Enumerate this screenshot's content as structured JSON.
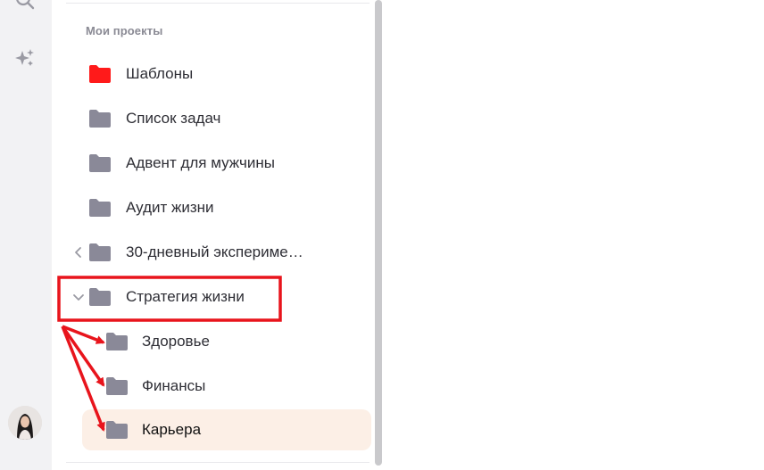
{
  "sidebar": {
    "section_title": "Мои проекты",
    "items": [
      {
        "label": "Шаблоны",
        "folder_color": "#ff1a1a",
        "chevron": "none",
        "level": 0
      },
      {
        "label": "Список задач",
        "folder_color": "#8a8998",
        "chevron": "none",
        "level": 0
      },
      {
        "label": "Адвент для мужчины",
        "folder_color": "#8a8998",
        "chevron": "none",
        "level": 0
      },
      {
        "label": "Аудит жизни",
        "folder_color": "#8a8998",
        "chevron": "none",
        "level": 0
      },
      {
        "label": "30-дневный экспериме…",
        "folder_color": "#8a8998",
        "chevron": "collapsed",
        "level": 0
      },
      {
        "label": "Стратегия жизни",
        "folder_color": "#8a8998",
        "chevron": "expanded",
        "level": 0
      },
      {
        "label": "Здоровье",
        "folder_color": "#8a8998",
        "chevron": "none",
        "level": 1
      },
      {
        "label": "Финансы",
        "folder_color": "#8a8998",
        "chevron": "none",
        "level": 1
      },
      {
        "label": "Карьера",
        "folder_color": "#8a8998",
        "chevron": "none",
        "level": 1,
        "selected": true
      }
    ]
  },
  "rail": {
    "icons": [
      "search-icon",
      "sparkle-icon"
    ],
    "avatar": "user-avatar"
  },
  "colors": {
    "accent_red": "#ff1a1a",
    "annotation_red": "#e8141c",
    "selected_bg": "#fcefe6",
    "folder_gray": "#8a8998"
  }
}
